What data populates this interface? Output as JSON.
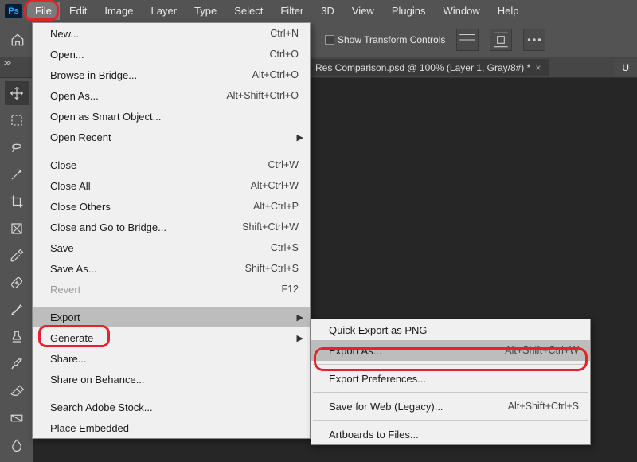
{
  "app": {
    "logo": "Ps"
  },
  "menubar": {
    "items": [
      "File",
      "Edit",
      "Image",
      "Layer",
      "Type",
      "Select",
      "Filter",
      "3D",
      "View",
      "Plugins",
      "Window",
      "Help"
    ]
  },
  "optionsbar": {
    "show_transform": "Show Transform Controls"
  },
  "document": {
    "tab_title": "Res Comparison.psd @ 100% (Layer 1, Gray/8#) *",
    "extra_tab": "U"
  },
  "file_menu": {
    "g1": [
      {
        "label": "New...",
        "shortcut": "Ctrl+N"
      },
      {
        "label": "Open...",
        "shortcut": "Ctrl+O"
      },
      {
        "label": "Browse in Bridge...",
        "shortcut": "Alt+Ctrl+O"
      },
      {
        "label": "Open As...",
        "shortcut": "Alt+Shift+Ctrl+O"
      },
      {
        "label": "Open as Smart Object...",
        "shortcut": ""
      },
      {
        "label": "Open Recent",
        "shortcut": "",
        "submenu": true
      }
    ],
    "g2": [
      {
        "label": "Close",
        "shortcut": "Ctrl+W"
      },
      {
        "label": "Close All",
        "shortcut": "Alt+Ctrl+W"
      },
      {
        "label": "Close Others",
        "shortcut": "Alt+Ctrl+P"
      },
      {
        "label": "Close and Go to Bridge...",
        "shortcut": "Shift+Ctrl+W"
      },
      {
        "label": "Save",
        "shortcut": "Ctrl+S"
      },
      {
        "label": "Save As...",
        "shortcut": "Shift+Ctrl+S"
      },
      {
        "label": "Revert",
        "shortcut": "F12",
        "disabled": true
      }
    ],
    "g3": [
      {
        "label": "Export",
        "shortcut": "",
        "submenu": true,
        "hov": true
      },
      {
        "label": "Generate",
        "shortcut": "",
        "submenu": true
      },
      {
        "label": "Share...",
        "shortcut": ""
      },
      {
        "label": "Share on Behance...",
        "shortcut": ""
      }
    ],
    "g4": [
      {
        "label": "Search Adobe Stock...",
        "shortcut": ""
      },
      {
        "label": "Place Embedded",
        "shortcut": ""
      }
    ]
  },
  "export_submenu": {
    "g1": [
      {
        "label": "Quick Export as PNG",
        "shortcut": ""
      },
      {
        "label": "Export As...",
        "shortcut": "Alt+Shift+Ctrl+W",
        "hov": true
      }
    ],
    "g2": [
      {
        "label": "Export Preferences...",
        "shortcut": ""
      }
    ],
    "g3": [
      {
        "label": "Save for Web (Legacy)...",
        "shortcut": "Alt+Shift+Ctrl+S"
      }
    ],
    "g4": [
      {
        "label": "Artboards to Files...",
        "shortcut": ""
      }
    ]
  },
  "tools": [
    "move",
    "marquee",
    "lasso",
    "wand",
    "crop",
    "frame",
    "eyedrop",
    "heal",
    "brush",
    "stamp",
    "history",
    "eraser",
    "gradient",
    "blur"
  ]
}
